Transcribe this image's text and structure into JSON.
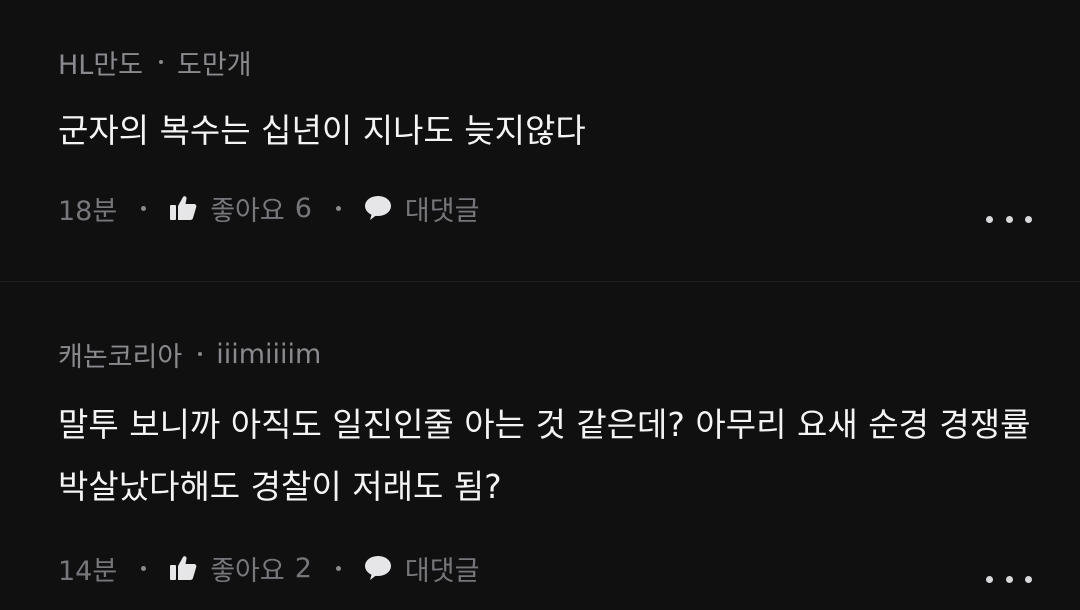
{
  "comments": [
    {
      "author": "HL만도",
      "handle": "도만개",
      "text": "군자의 복수는 십년이 지나도 늦지않다",
      "time": "18분",
      "like_label": "좋아요",
      "like_count": "6",
      "reply_label": "대댓글",
      "like_icon": "thumbs-up-icon",
      "reply_icon": "speech-bubble-icon",
      "more_icon": "more-dots-icon"
    },
    {
      "author": "캐논코리아",
      "handle": "iiimiiiim",
      "text": "말투 보니까 아직도 일진인줄 아는 것 같은데? 아무리 요새 순경 경쟁률 박살났다해도 경찰이 저래도 됨?",
      "time": "14분",
      "like_label": "좋아요",
      "like_count": "2",
      "reply_label": "대댓글",
      "like_icon": "thumbs-up-icon",
      "reply_icon": "speech-bubble-icon",
      "more_icon": "more-dots-icon"
    }
  ],
  "colors": {
    "background": "#101011",
    "text": "#f4f4f4",
    "meta": "#8a8a8e",
    "divider": "#202022"
  }
}
